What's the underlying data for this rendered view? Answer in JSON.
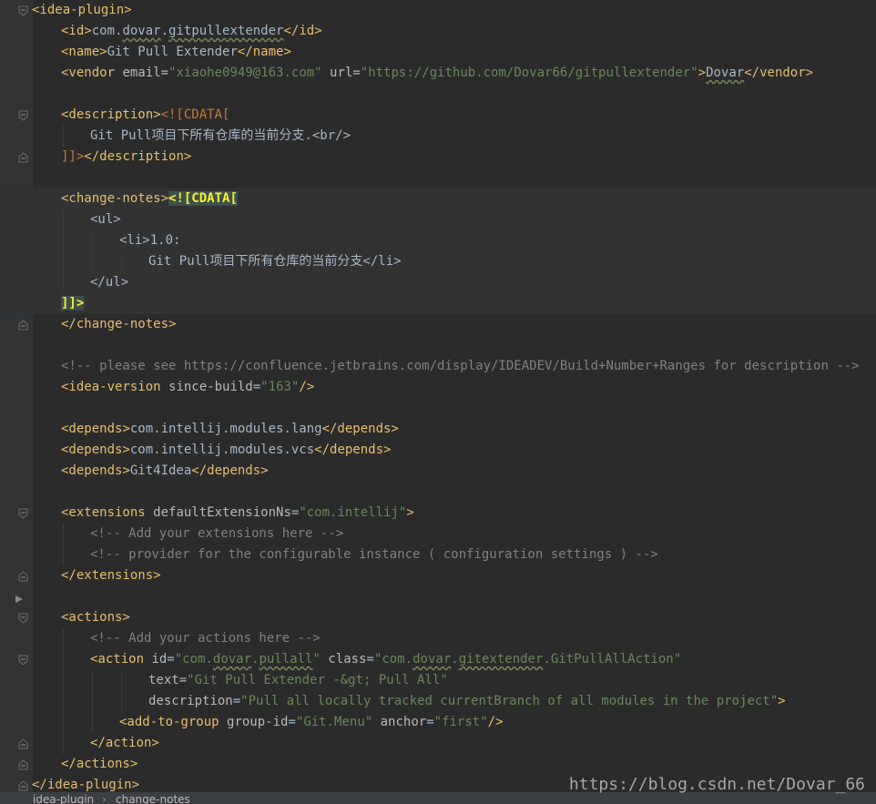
{
  "colors": {
    "background": "#2b2b2b",
    "tag": "#e8bf6a",
    "string": "#6a8759",
    "comment": "#808080",
    "cdata": "#cc7832",
    "cdata_highlight": "#ffef28"
  },
  "editor": {
    "language": "xml",
    "lines": [
      {
        "tokens": [
          {
            "c": "tag",
            "t": "<idea-plugin>"
          }
        ]
      },
      {
        "tokens": [
          {
            "c": "tag",
            "t": "<id>"
          },
          {
            "c": "text",
            "t": "com."
          },
          {
            "c": "text",
            "t": "dovar",
            "s": 1
          },
          {
            "c": "text",
            "t": "."
          },
          {
            "c": "text",
            "t": "gitpullextender",
            "s": 1
          },
          {
            "c": "tag",
            "t": "</id>"
          }
        ]
      },
      {
        "tokens": [
          {
            "c": "tag",
            "t": "<name>"
          },
          {
            "c": "text",
            "t": "Git Pull Extender"
          },
          {
            "c": "tag",
            "t": "</name>"
          }
        ]
      },
      {
        "tokens": [
          {
            "c": "tag",
            "t": "<vendor "
          },
          {
            "c": "attr",
            "t": "email"
          },
          {
            "c": "punct",
            "t": "="
          },
          {
            "c": "str",
            "t": "\"xiaohe0949@163.com\""
          },
          {
            "c": "attr",
            "t": " url"
          },
          {
            "c": "punct",
            "t": "="
          },
          {
            "c": "str",
            "t": "\"https://github.com/Dovar66/gitpullextender\""
          },
          {
            "c": "tag",
            "t": ">"
          },
          {
            "c": "text",
            "t": "Dovar",
            "s": 1
          },
          {
            "c": "tag",
            "t": "</vendor>"
          }
        ]
      },
      {
        "tokens": []
      },
      {
        "tokens": [
          {
            "c": "tag",
            "t": "<description>"
          },
          {
            "c": "cdata",
            "t": "<![CDATA["
          }
        ]
      },
      {
        "tokens": [
          {
            "c": "text",
            "t": "Git Pull项目下所有仓库的当前分支.<br/>"
          }
        ]
      },
      {
        "tokens": [
          {
            "c": "cdata",
            "t": "]]>"
          },
          {
            "c": "tag",
            "t": "</description>"
          }
        ]
      },
      {
        "tokens": []
      },
      {
        "tokens": [
          {
            "c": "tag",
            "t": "<change-notes>"
          },
          {
            "c": "cdata-hl",
            "t": "<![CDATA["
          }
        ]
      },
      {
        "tokens": [
          {
            "c": "text",
            "t": "<ul>"
          }
        ]
      },
      {
        "tokens": [
          {
            "c": "text",
            "t": "<li>1.0:"
          }
        ]
      },
      {
        "tokens": [
          {
            "c": "text",
            "t": "Git Pull项目下所有仓库的当前分支</li>"
          }
        ]
      },
      {
        "tokens": [
          {
            "c": "text",
            "t": "</ul>"
          }
        ]
      },
      {
        "tokens": [
          {
            "c": "cdata-hl",
            "t": "]]>"
          }
        ]
      },
      {
        "tokens": [
          {
            "c": "tag",
            "t": "</change-notes>"
          }
        ]
      },
      {
        "tokens": []
      },
      {
        "tokens": [
          {
            "c": "com",
            "t": "<!-- please see https://confluence.jetbrains.com/display/IDEADEV/Build+Number+Ranges for description -->"
          }
        ]
      },
      {
        "tokens": [
          {
            "c": "tag",
            "t": "<idea-version "
          },
          {
            "c": "attr",
            "t": "since-build"
          },
          {
            "c": "punct",
            "t": "="
          },
          {
            "c": "str",
            "t": "\"163\""
          },
          {
            "c": "tag",
            "t": "/>"
          }
        ]
      },
      {
        "tokens": []
      },
      {
        "tokens": [
          {
            "c": "tag",
            "t": "<depends>"
          },
          {
            "c": "text",
            "t": "com.intellij.modules.lang"
          },
          {
            "c": "tag",
            "t": "</depends>"
          }
        ]
      },
      {
        "tokens": [
          {
            "c": "tag",
            "t": "<depends>"
          },
          {
            "c": "text",
            "t": "com.intellij.modules.vcs"
          },
          {
            "c": "tag",
            "t": "</depends>"
          }
        ]
      },
      {
        "tokens": [
          {
            "c": "tag",
            "t": "<depends>"
          },
          {
            "c": "text",
            "t": "Git4Idea"
          },
          {
            "c": "tag",
            "t": "</depends>"
          }
        ]
      },
      {
        "tokens": []
      },
      {
        "tokens": [
          {
            "c": "tag",
            "t": "<extensions "
          },
          {
            "c": "attr",
            "t": "defaultExtensionNs"
          },
          {
            "c": "punct",
            "t": "="
          },
          {
            "c": "str",
            "t": "\"com.intellij\""
          },
          {
            "c": "tag",
            "t": ">"
          }
        ]
      },
      {
        "tokens": [
          {
            "c": "com",
            "t": "<!-- Add your extensions here -->"
          }
        ]
      },
      {
        "tokens": [
          {
            "c": "com",
            "t": "<!-- provider for the configurable instance ( configuration settings ) -->"
          }
        ]
      },
      {
        "tokens": [
          {
            "c": "tag",
            "t": "</extensions>"
          }
        ]
      },
      {
        "tokens": []
      },
      {
        "tokens": [
          {
            "c": "tag",
            "t": "<actions>"
          }
        ]
      },
      {
        "tokens": [
          {
            "c": "com",
            "t": "<!-- Add your actions here -->"
          }
        ]
      },
      {
        "tokens": [
          {
            "c": "tag",
            "t": "<action "
          },
          {
            "c": "attr",
            "t": "id"
          },
          {
            "c": "punct",
            "t": "="
          },
          {
            "c": "str",
            "t": "\"com."
          },
          {
            "c": "str",
            "t": "dovar",
            "s": 1
          },
          {
            "c": "str",
            "t": "."
          },
          {
            "c": "str",
            "t": "pullall",
            "s": 1
          },
          {
            "c": "str",
            "t": "\""
          },
          {
            "c": "attr",
            "t": " class"
          },
          {
            "c": "punct",
            "t": "="
          },
          {
            "c": "str",
            "t": "\"com."
          },
          {
            "c": "str",
            "t": "dovar",
            "s": 1
          },
          {
            "c": "str",
            "t": "."
          },
          {
            "c": "str",
            "t": "gitextender",
            "s": 1
          },
          {
            "c": "str",
            "t": ".GitPullAllAction\""
          }
        ]
      },
      {
        "tokens": [
          {
            "c": "attr",
            "t": "text"
          },
          {
            "c": "punct",
            "t": "="
          },
          {
            "c": "str",
            "t": "\"Git Pull Extender -&gt; Pull All\""
          }
        ]
      },
      {
        "tokens": [
          {
            "c": "attr",
            "t": "description"
          },
          {
            "c": "punct",
            "t": "="
          },
          {
            "c": "str",
            "t": "\"Pull all locally tracked currentBranch of all modules in the project\""
          },
          {
            "c": "tag",
            "t": ">"
          }
        ]
      },
      {
        "tokens": [
          {
            "c": "tag",
            "t": "<add-to-group "
          },
          {
            "c": "attr",
            "t": "group-id"
          },
          {
            "c": "punct",
            "t": "="
          },
          {
            "c": "str",
            "t": "\"Git.Menu\""
          },
          {
            "c": "attr",
            "t": " anchor"
          },
          {
            "c": "punct",
            "t": "="
          },
          {
            "c": "str",
            "t": "\"first\""
          },
          {
            "c": "tag",
            "t": "/>"
          }
        ]
      },
      {
        "tokens": [
          {
            "c": "tag",
            "t": "</action>"
          }
        ]
      },
      {
        "tokens": [
          {
            "c": "tag",
            "t": "</actions>"
          }
        ]
      },
      {
        "tokens": [
          {
            "c": "tag",
            "t": "</idea-plugin>"
          }
        ]
      }
    ]
  },
  "breadcrumb": {
    "items": [
      "idea-plugin",
      "change-notes"
    ],
    "separator": "›"
  },
  "watermark": "https://blog.csdn.net/Dovar_66"
}
